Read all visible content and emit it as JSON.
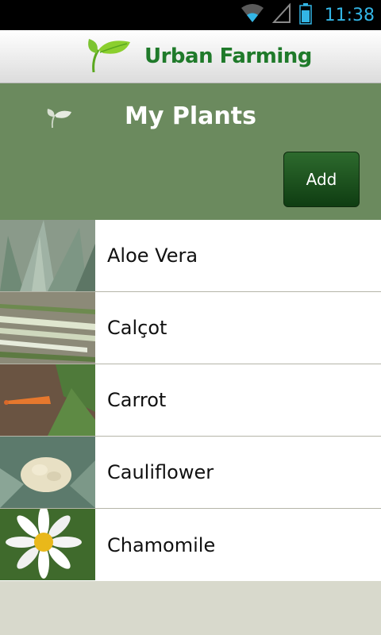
{
  "status_bar": {
    "time": "11:38",
    "icons": [
      "wifi-icon",
      "signal-icon",
      "battery-icon"
    ]
  },
  "header": {
    "app_name": "Urban Farming",
    "logo_icon": "leaf-sprout-icon"
  },
  "title_panel": {
    "title": "My Plants",
    "icon": "sprout-icon",
    "add_label": "Add"
  },
  "plants": [
    {
      "name": "Aloe Vera",
      "thumbnail": "aloe-vera-photo"
    },
    {
      "name": "Calçot",
      "thumbnail": "calcot-photo"
    },
    {
      "name": "Carrot",
      "thumbnail": "carrot-photo"
    },
    {
      "name": "Cauliflower",
      "thumbnail": "cauliflower-photo"
    },
    {
      "name": "Chamomile",
      "thumbnail": "chamomile-photo"
    }
  ],
  "colors": {
    "status_time": "#33b5e5",
    "brand_green": "#1f7a2a",
    "panel_green": "#6b8a5e",
    "button_green": "#1e4f1e",
    "background": "#d8d9cc"
  }
}
